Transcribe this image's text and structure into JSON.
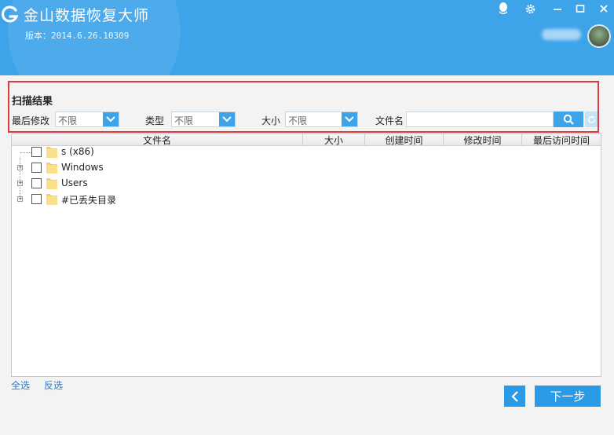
{
  "header": {
    "title": "金山数据恢复大师",
    "version": "版本：2014.6.26.10309"
  },
  "filters": {
    "section_title": "扫描结果",
    "modified": {
      "label": "最后修改",
      "value": "不限"
    },
    "type": {
      "label": "类型",
      "value": "不限"
    },
    "size": {
      "label": "大小",
      "value": "不限"
    },
    "filename": {
      "label": "文件名",
      "value": ""
    }
  },
  "table": {
    "columns": [
      "文件名",
      "大小",
      "创建时间",
      "修改时间",
      "最后访问时间"
    ],
    "rows": [
      {
        "name": "s (x86)",
        "expandable": false
      },
      {
        "name": "Windows",
        "expandable": true
      },
      {
        "name": "Users",
        "expandable": true
      },
      {
        "name": "#已丢失目录",
        "expandable": true
      }
    ]
  },
  "footer": {
    "select_all": "全选",
    "invert_select": "反选",
    "next_label": "下一步"
  },
  "colors": {
    "header_bg": "#3ea4ea",
    "accent": "#2a9ae6",
    "highlight_border": "#e03a3e",
    "folder": "#f7d267"
  }
}
